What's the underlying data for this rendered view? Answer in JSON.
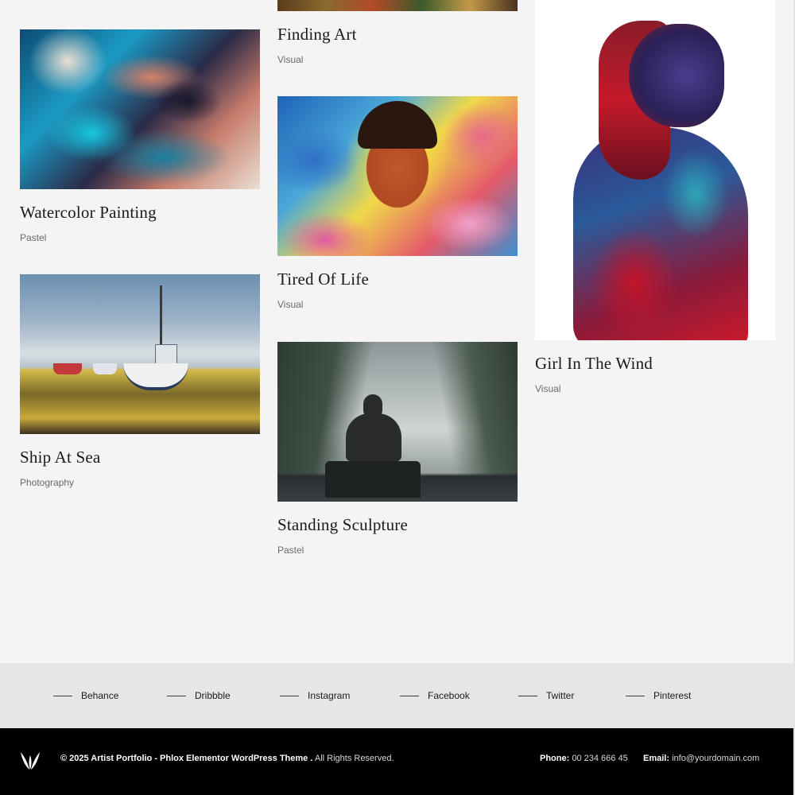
{
  "portfolio": {
    "items": [
      {
        "title": "Finding Art",
        "category": "Visual"
      },
      {
        "title": "Watercolor Painting",
        "category": "Pastel"
      },
      {
        "title": "Tired Of Life",
        "category": "Visual"
      },
      {
        "title": "Girl In The Wind",
        "category": "Visual"
      },
      {
        "title": "Ship At Sea",
        "category": "Photography"
      },
      {
        "title": "Standing Sculpture",
        "category": "Pastel"
      }
    ]
  },
  "social": {
    "links": [
      {
        "label": "Behance"
      },
      {
        "label": "Dribbble"
      },
      {
        "label": "Instagram"
      },
      {
        "label": "Facebook"
      },
      {
        "label": "Twitter"
      },
      {
        "label": "Pinterest"
      }
    ]
  },
  "footer": {
    "copyright_bold": "© 2025 Artist Portfolio - Phlox Elementor WordPress Theme .",
    "copyright_rest": " All Rights Reserved.",
    "phone_label": "Phone:",
    "phone_value": " 00 234 666 45",
    "email_label": "Email:",
    "email_value": " info@yourdomain.com"
  },
  "colors": {
    "page_background": "#f4f4f4",
    "social_bar_background": "#e6e6e6",
    "footer_background": "#000000"
  }
}
